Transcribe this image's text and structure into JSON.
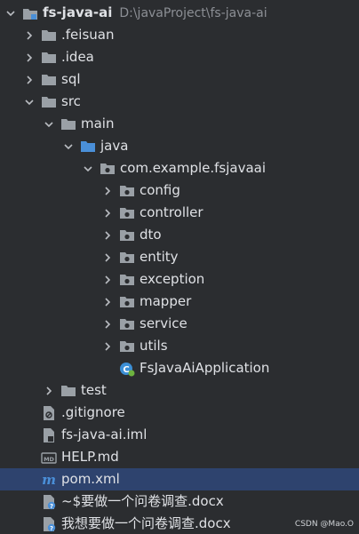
{
  "colors": {
    "background": "#2b2d30",
    "selection": "#2e436e",
    "folder": "#9aa0a6",
    "source_folder": "#4a8fd8",
    "text": "#dfe1e5"
  },
  "tree": {
    "project": {
      "name": "fs-java-ai",
      "path": "D:\\javaProject\\fs-java-ai"
    },
    "feisuan": ".feisuan",
    "idea": ".idea",
    "sql": "sql",
    "src": "src",
    "main": "main",
    "java": "java",
    "package": "com.example.fsjavaai",
    "config": "config",
    "controller": "controller",
    "dto": "dto",
    "entity": "entity",
    "exception": "exception",
    "mapper": "mapper",
    "service": "service",
    "utils": "utils",
    "app_class": "FsJavaAiApplication",
    "test": "test",
    "gitignore": ".gitignore",
    "iml": "fs-java-ai.iml",
    "help": "HELP.md",
    "md_badge": "MD",
    "pom": "pom.xml",
    "temp_doc": "~$要做一个问卷调查.docx",
    "doc": "我想要做一个问卷调查.docx"
  },
  "watermark": "CSDN @Mao.O"
}
